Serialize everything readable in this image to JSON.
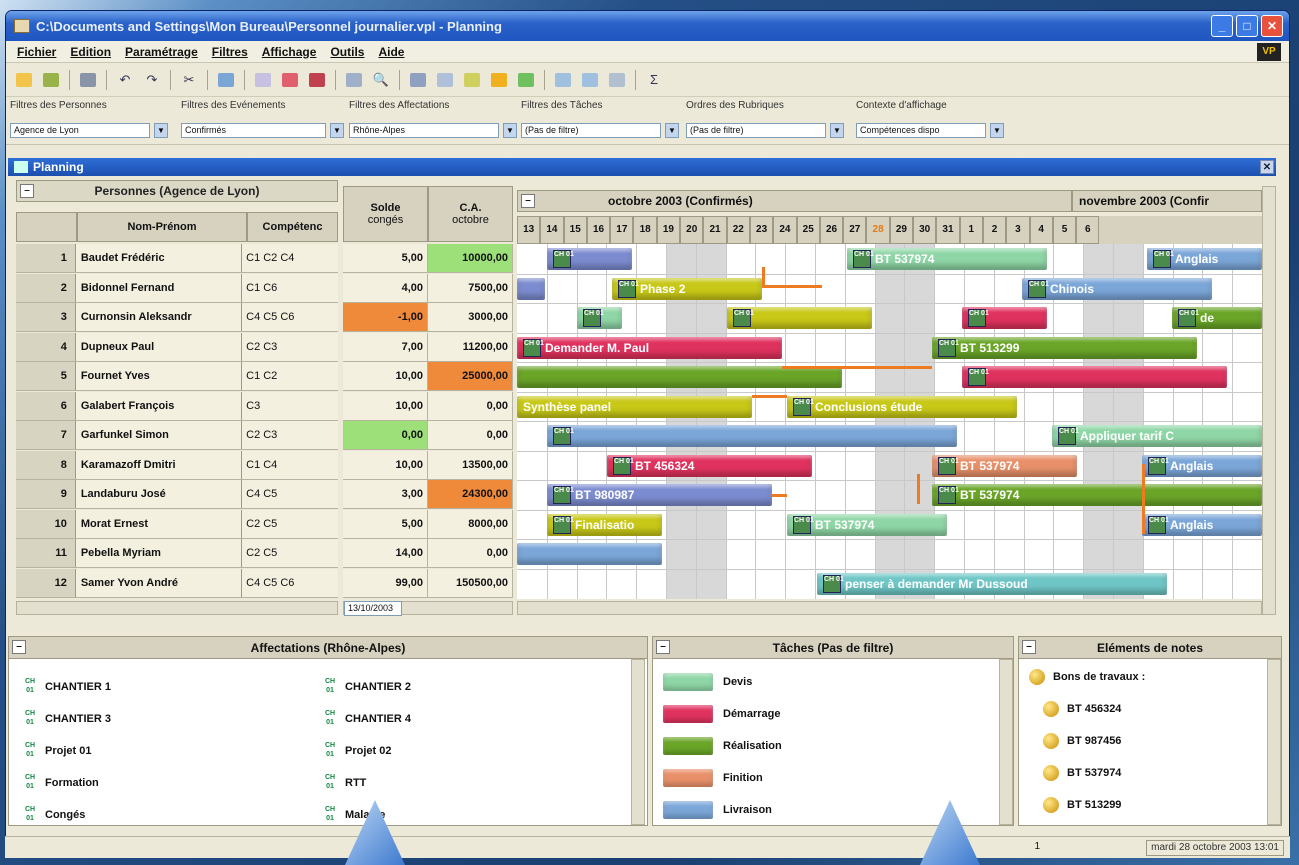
{
  "window": {
    "title": "C:\\Documents and Settings\\Mon Bureau\\Personnel journalier.vpl - Planning"
  },
  "menu": [
    "Fichier",
    "Edition",
    "Paramétrage",
    "Filtres",
    "Affichage",
    "Outils",
    "Aide"
  ],
  "logo_text": "VP",
  "filters": [
    {
      "label": "Filtres des Personnes",
      "value": "Agence de Lyon"
    },
    {
      "label": "Filtres des Evénements",
      "value": "Confirmés"
    },
    {
      "label": "Filtres des Affectations",
      "value": "Rhône-Alpes"
    },
    {
      "label": "Filtres des Tâches",
      "value": "(Pas de filtre)"
    },
    {
      "label": "Ordres des Rubriques",
      "value": "(Pas de filtre)"
    },
    {
      "label": "Contexte d'affichage",
      "value": "Compétences dispo"
    }
  ],
  "planning": {
    "title": "Planning",
    "persons_header": "Personnes (Agence de Lyon)",
    "col_name": "Nom-Prénom",
    "col_comp": "Compétenc",
    "col_solde": "Solde congés",
    "col_ca": "C.A. octobre",
    "solde_head": "Solde",
    "solde_sub": "congés",
    "ca_head": "C.A.",
    "ca_sub": "octobre",
    "month1": "octobre 2003 (Confirmés)",
    "month2": "novembre 2003 (Confir",
    "days": [
      "13",
      "14",
      "15",
      "16",
      "17",
      "18",
      "19",
      "20",
      "21",
      "22",
      "23",
      "24",
      "25",
      "26",
      "27",
      "28",
      "29",
      "30",
      "31",
      "1",
      "2",
      "3",
      "4",
      "5",
      "6"
    ],
    "rows": [
      {
        "n": "1",
        "name": "Baudet Frédéric",
        "comp": "C1 C2 C4",
        "solde": "5,00",
        "ca": "10000,00"
      },
      {
        "n": "2",
        "name": "Bidonnel Fernand",
        "comp": "C1 C6",
        "solde": "4,00",
        "ca": "7500,00"
      },
      {
        "n": "3",
        "name": "Curnonsin Aleksandr",
        "comp": "C4 C5 C6",
        "solde": "-1,00",
        "ca": "3000,00"
      },
      {
        "n": "4",
        "name": "Dupneux Paul",
        "comp": "C2 C3",
        "solde": "7,00",
        "ca": "11200,00"
      },
      {
        "n": "5",
        "name": "Fournet Yves",
        "comp": "C1 C2",
        "solde": "10,00",
        "ca": "25000,00"
      },
      {
        "n": "6",
        "name": "Galabert François",
        "comp": "C3",
        "solde": "10,00",
        "ca": "0,00"
      },
      {
        "n": "7",
        "name": "Garfunkel Simon",
        "comp": "C2 C3",
        "solde": "0,00",
        "ca": "0,00"
      },
      {
        "n": "8",
        "name": "Karamazoff Dmitri",
        "comp": "C1 C4",
        "solde": "10,00",
        "ca": "13500,00"
      },
      {
        "n": "9",
        "name": "Landaburu José",
        "comp": "C4 C5",
        "solde": "3,00",
        "ca": "24300,00"
      },
      {
        "n": "10",
        "name": "Morat Ernest",
        "comp": "C2 C5",
        "solde": "5,00",
        "ca": "8000,00"
      },
      {
        "n": "11",
        "name": "Pebella Myriam",
        "comp": "C2 C5",
        "solde": "14,00",
        "ca": "0,00"
      },
      {
        "n": "12",
        "name": "Samer Yvon André",
        "comp": "C4 C5 C6",
        "solde": "99,00",
        "ca": "150500,00"
      }
    ],
    "bars": {
      "b1": "BT 537974",
      "b2": "Anglais",
      "b3": "Phase 2",
      "b4": "Chinois",
      "b5": "de",
      "b6": "Demander M. Paul",
      "b7": "BT 513299",
      "b8": "Synthèse panel",
      "b9": "Conclusions étude",
      "b10": "Appliquer tarif C",
      "b11": "BT 456324",
      "b12": "BT 537974",
      "b13": "Anglais",
      "b14": "BT 980987",
      "b15": "BT 537974",
      "b16": "Finalisatio",
      "b17": "BT 537974",
      "b18": "Anglais",
      "b19": "penser à demander Mr Dussoud"
    },
    "date_field": "13/10/2003"
  },
  "affectations": {
    "title": "Affectations (Rhône-Alpes)",
    "items": [
      "CHANTIER 1",
      "CHANTIER 2",
      "CHANTIER 3",
      "CHANTIER 4",
      "Projet 01",
      "Projet 02",
      "Formation",
      "RTT",
      "Congés",
      "Maladie"
    ]
  },
  "taches": {
    "title": "Tâches (Pas de filtre)",
    "items": [
      {
        "label": "Devis",
        "color": "#8fd6a6"
      },
      {
        "label": "Démarrage",
        "color": "#e0325e"
      },
      {
        "label": "Réalisation",
        "color": "#6aa528"
      },
      {
        "label": "Finition",
        "color": "#e8906a"
      },
      {
        "label": "Livraison",
        "color": "#7ba6d8"
      }
    ]
  },
  "notes": {
    "title": "Eléments de notes",
    "header": "Bons de travaux :",
    "items": [
      "BT 456324",
      "BT 987456",
      "BT 537974",
      "BT 513299"
    ]
  },
  "status": {
    "count": "1",
    "date": "mardi 28 octobre 2003 13:01"
  }
}
